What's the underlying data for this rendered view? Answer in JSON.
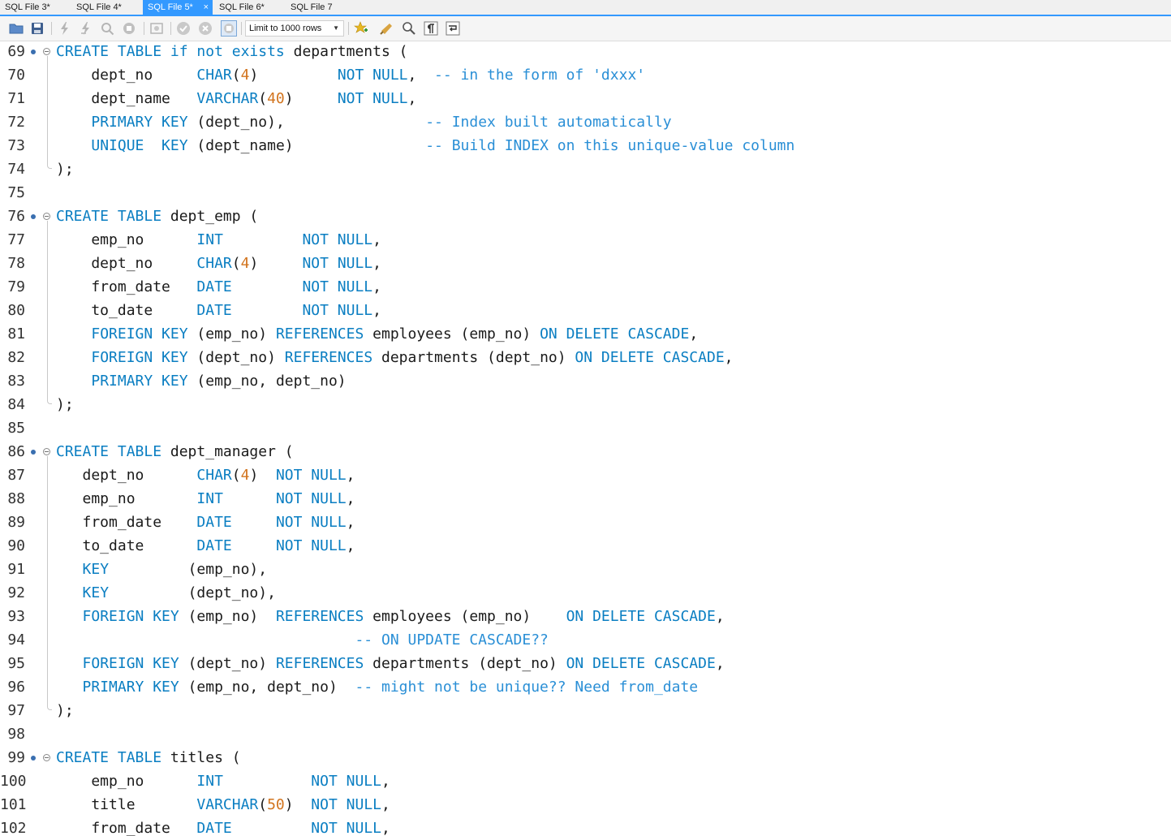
{
  "tabs": [
    {
      "label": "SQL File 3*",
      "active": false
    },
    {
      "label": "SQL File 4*",
      "active": false
    },
    {
      "label": "SQL File 5*",
      "active": true,
      "close": "×"
    },
    {
      "label": "SQL File 6*",
      "active": false
    },
    {
      "label": "SQL File 7",
      "active": false
    }
  ],
  "toolbar": {
    "limit_select": "Limit to 1000 rows",
    "icons": [
      "open-folder-icon",
      "save-icon",
      "execute-icon",
      "execute-current-icon",
      "explain-icon",
      "stop-icon",
      "toggle-output-icon",
      "commit-icon",
      "rollback-icon",
      "autocommit-icon",
      "favorite-snippet-icon",
      "beautify-icon",
      "find-icon",
      "invisible-chars-icon",
      "wrap-lines-icon"
    ]
  },
  "colors": {
    "keyword": "#0a7ec2",
    "number": "#d2741e",
    "comment": "#2a8fd6",
    "identifier": "#1a1a1a",
    "accent": "#3399ff"
  },
  "editor": {
    "lines": [
      {
        "n": "69",
        "mark": true,
        "fold": "start",
        "seg": [
          [
            "k",
            "CREATE TABLE if not exists"
          ],
          [
            "t",
            " departments ("
          ]
        ]
      },
      {
        "n": "70",
        "seg": [
          [
            "t",
            "    dept_no     "
          ],
          [
            "k",
            "CHAR"
          ],
          [
            "t",
            "("
          ],
          [
            "n",
            "4"
          ],
          [
            "t",
            ")         "
          ],
          [
            "k",
            "NOT NULL"
          ],
          [
            "t",
            ",  "
          ],
          [
            "c",
            "-- in the form of 'dxxx'"
          ]
        ]
      },
      {
        "n": "71",
        "seg": [
          [
            "t",
            "    dept_name   "
          ],
          [
            "k",
            "VARCHAR"
          ],
          [
            "t",
            "("
          ],
          [
            "n",
            "40"
          ],
          [
            "t",
            ")     "
          ],
          [
            "k",
            "NOT NULL"
          ],
          [
            "t",
            ","
          ]
        ]
      },
      {
        "n": "72",
        "seg": [
          [
            "t",
            "    "
          ],
          [
            "k",
            "PRIMARY KEY"
          ],
          [
            "t",
            " (dept_no),                "
          ],
          [
            "c",
            "-- Index built automatically"
          ]
        ]
      },
      {
        "n": "73",
        "seg": [
          [
            "t",
            "    "
          ],
          [
            "k",
            "UNIQUE  KEY"
          ],
          [
            "t",
            " (dept_name)               "
          ],
          [
            "c",
            "-- Build INDEX on this unique-value column"
          ]
        ]
      },
      {
        "n": "74",
        "fold": "end",
        "seg": [
          [
            "t",
            ");"
          ]
        ]
      },
      {
        "n": "75",
        "seg": []
      },
      {
        "n": "76",
        "mark": true,
        "fold": "start",
        "seg": [
          [
            "k",
            "CREATE TABLE"
          ],
          [
            "t",
            " dept_emp ("
          ]
        ]
      },
      {
        "n": "77",
        "seg": [
          [
            "t",
            "    emp_no      "
          ],
          [
            "k",
            "INT"
          ],
          [
            "t",
            "         "
          ],
          [
            "k",
            "NOT NULL"
          ],
          [
            "t",
            ","
          ]
        ]
      },
      {
        "n": "78",
        "seg": [
          [
            "t",
            "    dept_no     "
          ],
          [
            "k",
            "CHAR"
          ],
          [
            "t",
            "("
          ],
          [
            "n",
            "4"
          ],
          [
            "t",
            ")     "
          ],
          [
            "k",
            "NOT NULL"
          ],
          [
            "t",
            ","
          ]
        ]
      },
      {
        "n": "79",
        "seg": [
          [
            "t",
            "    from_date   "
          ],
          [
            "k",
            "DATE"
          ],
          [
            "t",
            "        "
          ],
          [
            "k",
            "NOT NULL"
          ],
          [
            "t",
            ","
          ]
        ]
      },
      {
        "n": "80",
        "seg": [
          [
            "t",
            "    to_date     "
          ],
          [
            "k",
            "DATE"
          ],
          [
            "t",
            "        "
          ],
          [
            "k",
            "NOT NULL"
          ],
          [
            "t",
            ","
          ]
        ]
      },
      {
        "n": "81",
        "seg": [
          [
            "t",
            "    "
          ],
          [
            "k",
            "FOREIGN KEY"
          ],
          [
            "t",
            " (emp_no) "
          ],
          [
            "k",
            "REFERENCES"
          ],
          [
            "t",
            " employees (emp_no) "
          ],
          [
            "k",
            "ON DELETE CASCADE"
          ],
          [
            "t",
            ","
          ]
        ]
      },
      {
        "n": "82",
        "seg": [
          [
            "t",
            "    "
          ],
          [
            "k",
            "FOREIGN KEY"
          ],
          [
            "t",
            " (dept_no) "
          ],
          [
            "k",
            "REFERENCES"
          ],
          [
            "t",
            " departments (dept_no) "
          ],
          [
            "k",
            "ON DELETE CASCADE"
          ],
          [
            "t",
            ","
          ]
        ]
      },
      {
        "n": "83",
        "seg": [
          [
            "t",
            "    "
          ],
          [
            "k",
            "PRIMARY KEY"
          ],
          [
            "t",
            " (emp_no, dept_no)"
          ]
        ]
      },
      {
        "n": "84",
        "fold": "end",
        "seg": [
          [
            "t",
            ");"
          ]
        ]
      },
      {
        "n": "85",
        "seg": []
      },
      {
        "n": "86",
        "mark": true,
        "fold": "start",
        "seg": [
          [
            "k",
            "CREATE TABLE"
          ],
          [
            "t",
            " dept_manager ("
          ]
        ]
      },
      {
        "n": "87",
        "seg": [
          [
            "t",
            "   dept_no      "
          ],
          [
            "k",
            "CHAR"
          ],
          [
            "t",
            "("
          ],
          [
            "n",
            "4"
          ],
          [
            "t",
            ")  "
          ],
          [
            "k",
            "NOT NULL"
          ],
          [
            "t",
            ","
          ]
        ]
      },
      {
        "n": "88",
        "seg": [
          [
            "t",
            "   emp_no       "
          ],
          [
            "k",
            "INT"
          ],
          [
            "t",
            "      "
          ],
          [
            "k",
            "NOT NULL"
          ],
          [
            "t",
            ","
          ]
        ]
      },
      {
        "n": "89",
        "seg": [
          [
            "t",
            "   from_date    "
          ],
          [
            "k",
            "DATE"
          ],
          [
            "t",
            "     "
          ],
          [
            "k",
            "NOT NULL"
          ],
          [
            "t",
            ","
          ]
        ]
      },
      {
        "n": "90",
        "seg": [
          [
            "t",
            "   to_date      "
          ],
          [
            "k",
            "DATE"
          ],
          [
            "t",
            "     "
          ],
          [
            "k",
            "NOT NULL"
          ],
          [
            "t",
            ","
          ]
        ]
      },
      {
        "n": "91",
        "seg": [
          [
            "t",
            "   "
          ],
          [
            "k",
            "KEY"
          ],
          [
            "t",
            "         (emp_no),"
          ]
        ]
      },
      {
        "n": "92",
        "seg": [
          [
            "t",
            "   "
          ],
          [
            "k",
            "KEY"
          ],
          [
            "t",
            "         (dept_no),"
          ]
        ]
      },
      {
        "n": "93",
        "seg": [
          [
            "t",
            "   "
          ],
          [
            "k",
            "FOREIGN KEY"
          ],
          [
            "t",
            " (emp_no)  "
          ],
          [
            "k",
            "REFERENCES"
          ],
          [
            "t",
            " employees (emp_no)    "
          ],
          [
            "k",
            "ON DELETE CASCADE"
          ],
          [
            "t",
            ","
          ]
        ]
      },
      {
        "n": "94",
        "seg": [
          [
            "t",
            "                                  "
          ],
          [
            "c",
            "-- ON UPDATE CASCADE??"
          ]
        ]
      },
      {
        "n": "95",
        "seg": [
          [
            "t",
            "   "
          ],
          [
            "k",
            "FOREIGN KEY"
          ],
          [
            "t",
            " (dept_no) "
          ],
          [
            "k",
            "REFERENCES"
          ],
          [
            "t",
            " departments (dept_no) "
          ],
          [
            "k",
            "ON DELETE CASCADE"
          ],
          [
            "t",
            ","
          ]
        ]
      },
      {
        "n": "96",
        "seg": [
          [
            "t",
            "   "
          ],
          [
            "k",
            "PRIMARY KEY"
          ],
          [
            "t",
            " (emp_no, dept_no)  "
          ],
          [
            "c",
            "-- might not be unique?? Need from_date"
          ]
        ]
      },
      {
        "n": "97",
        "fold": "end",
        "seg": [
          [
            "t",
            ");"
          ]
        ]
      },
      {
        "n": "98",
        "seg": []
      },
      {
        "n": "99",
        "mark": true,
        "fold": "start",
        "seg": [
          [
            "k",
            "CREATE TABLE"
          ],
          [
            "t",
            " titles ("
          ]
        ]
      },
      {
        "n": "100",
        "seg": [
          [
            "t",
            "    emp_no      "
          ],
          [
            "k",
            "INT"
          ],
          [
            "t",
            "          "
          ],
          [
            "k",
            "NOT NULL"
          ],
          [
            "t",
            ","
          ]
        ]
      },
      {
        "n": "101",
        "seg": [
          [
            "t",
            "    title       "
          ],
          [
            "k",
            "VARCHAR"
          ],
          [
            "t",
            "("
          ],
          [
            "n",
            "50"
          ],
          [
            "t",
            ")  "
          ],
          [
            "k",
            "NOT NULL"
          ],
          [
            "t",
            ","
          ]
        ]
      },
      {
        "n": "102",
        "seg": [
          [
            "t",
            "    from_date   "
          ],
          [
            "k",
            "DATE"
          ],
          [
            "t",
            "         "
          ],
          [
            "k",
            "NOT NULL"
          ],
          [
            "t",
            ","
          ]
        ]
      }
    ]
  }
}
